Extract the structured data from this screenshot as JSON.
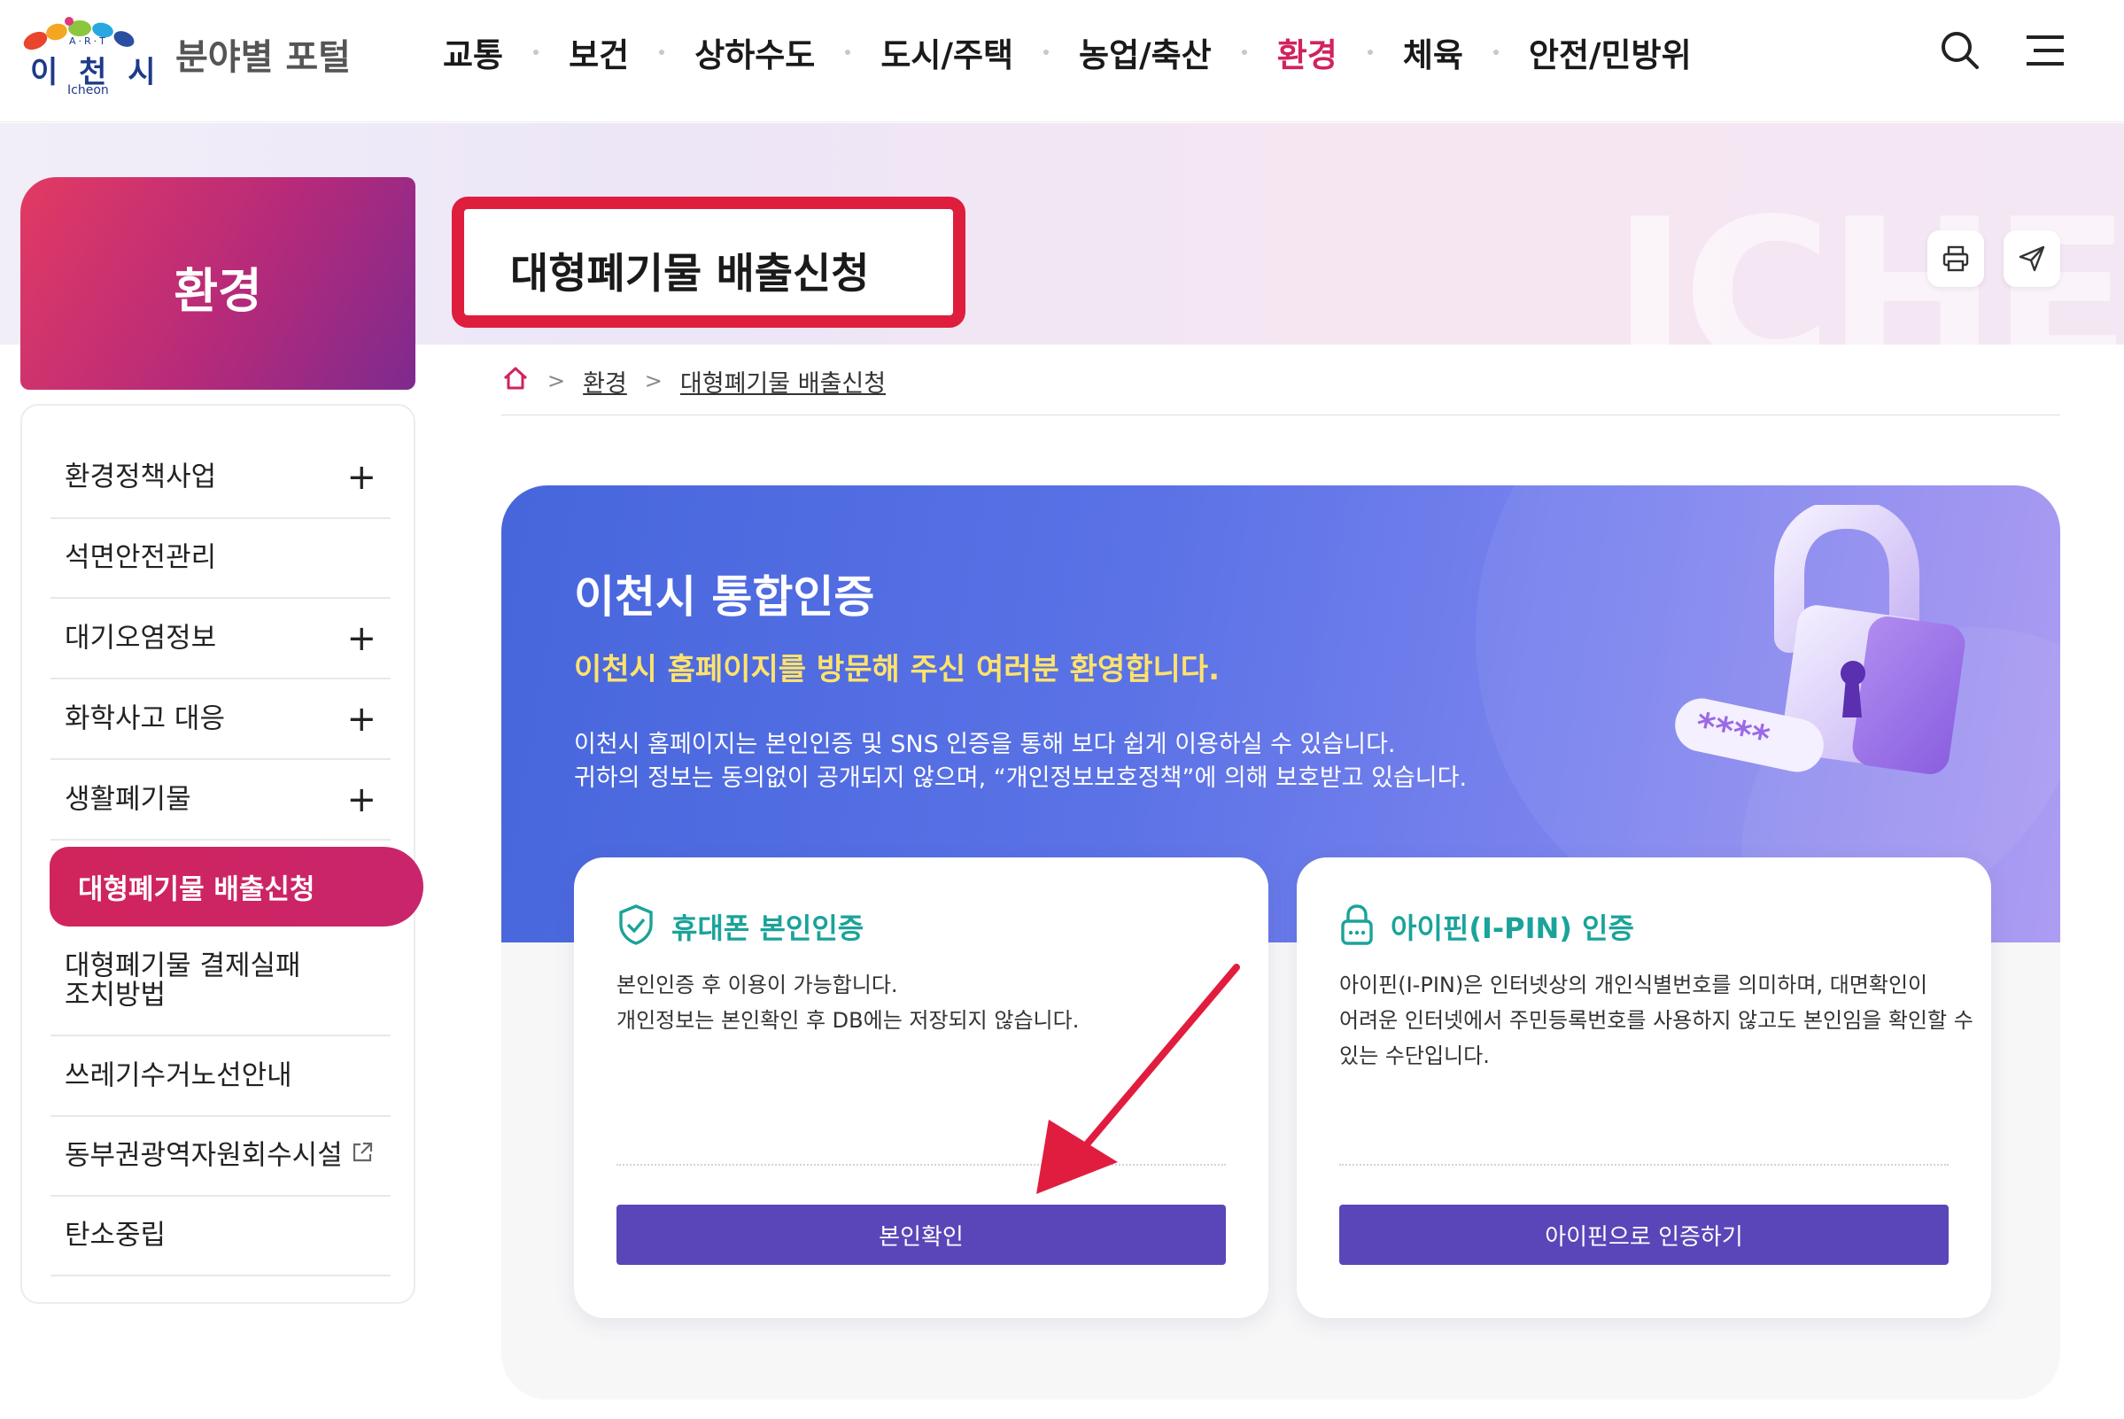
{
  "header": {
    "logo_korean": "이 천 시",
    "logo_art": "A·R·T",
    "logo_english": "Icheon",
    "portal_title": "분야별 포털",
    "nav": [
      {
        "label": "교통",
        "active": false
      },
      {
        "label": "보건",
        "active": false
      },
      {
        "label": "상하수도",
        "active": false
      },
      {
        "label": "도시/주택",
        "active": false
      },
      {
        "label": "농업/축산",
        "active": false
      },
      {
        "label": "환경",
        "active": true
      },
      {
        "label": "체육",
        "active": false
      },
      {
        "label": "안전/민방위",
        "active": false
      }
    ],
    "search_icon": "search-icon",
    "menu_icon": "hamburger-menu-icon"
  },
  "hero": {
    "section_title": "환경",
    "page_title": "대형폐기물 배출신청",
    "background_text": "ICHEO"
  },
  "tools": {
    "print_icon": "printer-icon",
    "share_icon": "send-icon"
  },
  "breadcrumb": {
    "home_icon": "home-icon",
    "items": [
      "환경",
      "대형폐기물 배출신청"
    ]
  },
  "sidebar": {
    "items": [
      {
        "label": "환경정책사업",
        "expandable": true
      },
      {
        "label": "석면안전관리",
        "expandable": false
      },
      {
        "label": "대기오염정보",
        "expandable": true
      },
      {
        "label": "화학사고 대응",
        "expandable": true
      },
      {
        "label": "생활폐기물",
        "expandable": true
      },
      {
        "label": "대형폐기물 배출신청",
        "active": true
      },
      {
        "label": "대형폐기물 결제실패",
        "label2": "조치방법"
      },
      {
        "label": "쓰레기수거노선안내"
      },
      {
        "label": "동부권광역자원회수시설",
        "external": true
      },
      {
        "label": "탄소중립"
      }
    ]
  },
  "auth": {
    "title": "이천시 통합인증",
    "subtitle": "이천시 홈페이지를 방문해 주신 여러분 환영합니다.",
    "desc1": "이천시 홈페이지는 본인인증 및 SNS 인증을 통해 보다 쉽게 이용하실 수 있습니다.",
    "desc2": "귀하의 정보는 동의없이 공개되지 않으며, “개인정보보호정책”에 의해 보호받고 있습니다.",
    "lock_stars": "****",
    "cards": [
      {
        "icon": "shield-check-icon",
        "title": "휴대폰 본인인증",
        "lines": [
          "본인인증 후 이용이 가능합니다.",
          "개인정보는 본인확인 후 DB에는 저장되지 않습니다."
        ],
        "button": "본인확인"
      },
      {
        "icon": "padlock-icon",
        "title": "아이핀(I-PIN) 인증",
        "lines": [
          "아이핀(I-PIN)은 인터넷상의 개인식별번호를 의미하며, 대면확인이",
          "어려운 인터넷에서 주민등록번호를 사용하지 않고도 본인임을 확인할 수",
          "있는 수단입니다."
        ],
        "button": "아이핀으로 인증하기"
      }
    ]
  },
  "colors": {
    "accent": "#d1235c",
    "highlight_box": "#de1e3c",
    "button": "#5a46b8",
    "card_title": "#1aa39a",
    "subtitle_yellow": "#ffe36b"
  }
}
